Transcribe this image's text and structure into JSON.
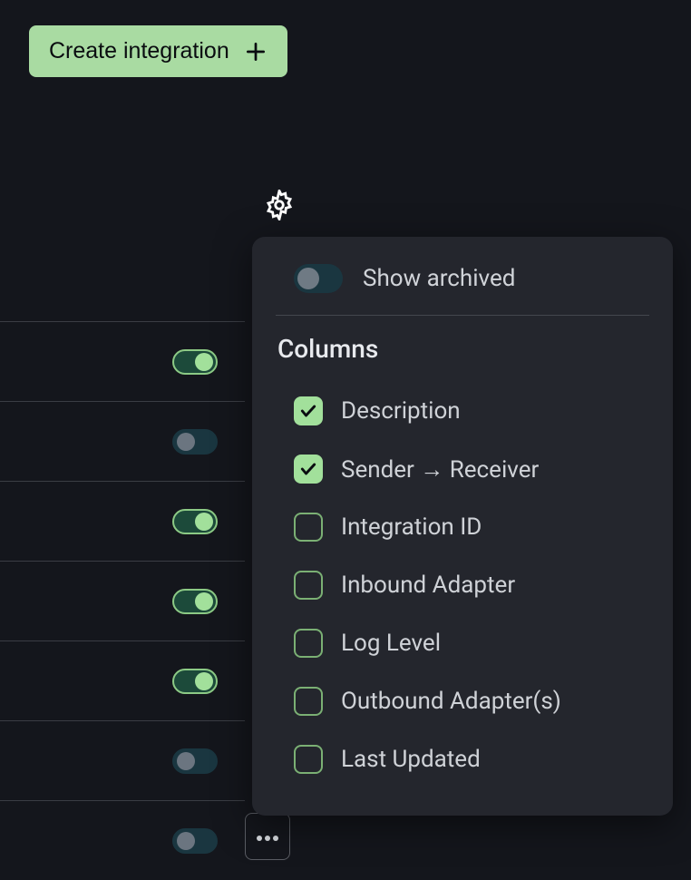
{
  "header": {
    "create_label": "Create integration"
  },
  "rows": [
    {
      "on": true
    },
    {
      "on": false
    },
    {
      "on": true
    },
    {
      "on": true
    },
    {
      "on": true
    },
    {
      "on": false
    },
    {
      "on": false
    }
  ],
  "popup": {
    "show_archived_label": "Show archived",
    "show_archived_on": false,
    "columns_title": "Columns",
    "columns": [
      {
        "label": "Description",
        "checked": true
      },
      {
        "label": "Sender → Receiver",
        "checked": true
      },
      {
        "label": "Integration ID",
        "checked": false
      },
      {
        "label": "Inbound Adapter",
        "checked": false
      },
      {
        "label": "Log Level",
        "checked": false
      },
      {
        "label": "Outbound Adapter(s)",
        "checked": false
      },
      {
        "label": "Last Updated",
        "checked": false
      }
    ]
  }
}
